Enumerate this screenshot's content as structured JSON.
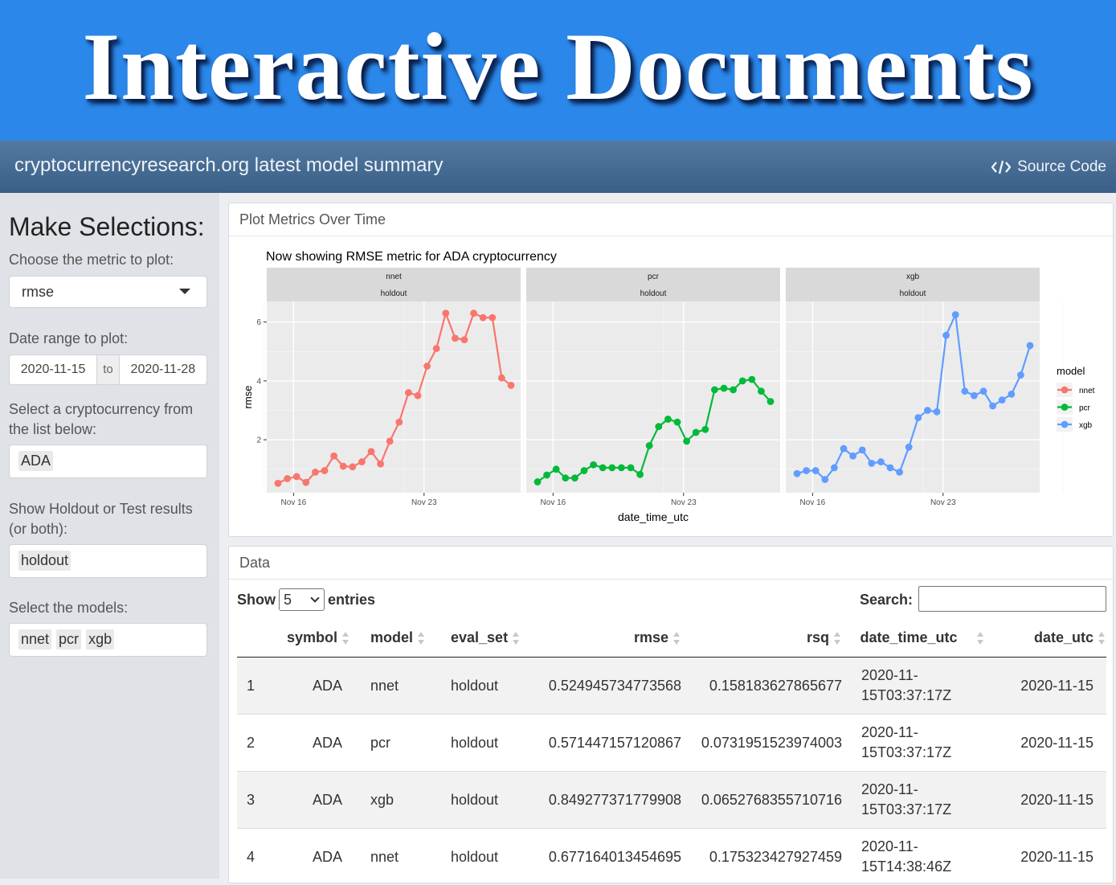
{
  "banner": {
    "title": "Interactive Documents"
  },
  "navbar": {
    "title": "cryptocurrencyresearch.org latest model summary",
    "source_code": "Source Code"
  },
  "sidebar": {
    "heading": "Make Selections:",
    "metric_label": "Choose the metric to plot:",
    "metric_value": "rmse",
    "date_label": "Date range to plot:",
    "date_start": "2020-11-15",
    "date_to": "to",
    "date_end": "2020-11-28",
    "crypto_label": "Select a cryptocurrency from the list below:",
    "crypto_tags": [
      "ADA"
    ],
    "holdout_label": "Show Holdout or Test results (or both):",
    "holdout_tags": [
      "holdout"
    ],
    "models_label": "Select the models:",
    "models_tags": [
      "nnet",
      "pcr",
      "xgb"
    ]
  },
  "plot_panel": {
    "title": "Plot Metrics Over Time"
  },
  "chart_data": {
    "type": "line",
    "title": "Now showing RMSE metric for ADA cryptocurrency",
    "xlabel": "date_time_utc",
    "ylabel": "rmse",
    "x_ticks": [
      "Nov 16",
      "Nov 23"
    ],
    "y_ticks": [
      2,
      4,
      6
    ],
    "ylim": [
      0.2,
      6.7
    ],
    "legend_title": "model",
    "legend_position": "right",
    "strip_bottom": "holdout",
    "series": [
      {
        "name": "nnet",
        "color": "#f8766d",
        "values": [
          0.52,
          0.68,
          0.75,
          0.55,
          0.9,
          0.95,
          1.45,
          1.1,
          1.08,
          1.25,
          1.6,
          1.18,
          1.95,
          2.6,
          3.6,
          3.5,
          4.5,
          5.1,
          6.3,
          5.45,
          5.4,
          6.3,
          6.15,
          6.15,
          4.1,
          3.85
        ]
      },
      {
        "name": "pcr",
        "color": "#00ba38",
        "values": [
          0.57,
          0.8,
          1.0,
          0.7,
          0.7,
          0.95,
          1.15,
          1.05,
          1.05,
          1.05,
          1.05,
          0.82,
          1.8,
          2.45,
          2.7,
          2.6,
          1.95,
          2.25,
          2.35,
          3.7,
          3.75,
          3.7,
          4.0,
          4.05,
          3.65,
          3.3
        ]
      },
      {
        "name": "xgb",
        "color": "#619cff",
        "values": [
          0.85,
          0.95,
          0.95,
          0.65,
          1.05,
          1.7,
          1.45,
          1.65,
          1.2,
          1.25,
          1.05,
          0.9,
          1.75,
          2.75,
          3.0,
          2.95,
          5.55,
          6.25,
          3.65,
          3.5,
          3.65,
          3.15,
          3.35,
          3.55,
          4.2,
          5.2
        ]
      }
    ]
  },
  "data_panel": {
    "title": "Data",
    "show_label": "Show",
    "entries_value": "5",
    "entries_label": "entries",
    "search_label": "Search:",
    "columns": [
      "symbol",
      "model",
      "eval_set",
      "rmse",
      "rsq",
      "date_time_utc",
      "date_utc"
    ],
    "rows": [
      [
        "1",
        "ADA",
        "nnet",
        "holdout",
        "0.524945734773568",
        "0.158183627865677",
        "2020-11-",
        "15T03:37:17Z",
        "2020-11-15"
      ],
      [
        "2",
        "ADA",
        "pcr",
        "holdout",
        "0.571447157120867",
        "0.0731951523974003",
        "2020-11-",
        "15T03:37:17Z",
        "2020-11-15"
      ],
      [
        "3",
        "ADA",
        "xgb",
        "holdout",
        "0.849277371779908",
        "0.0652768355710716",
        "2020-11-",
        "15T03:37:17Z",
        "2020-11-15"
      ],
      [
        "4",
        "ADA",
        "nnet",
        "holdout",
        "0.677164013454695",
        "0.175323427927459",
        "2020-11-",
        "15T14:38:46Z",
        "2020-11-15"
      ]
    ]
  }
}
